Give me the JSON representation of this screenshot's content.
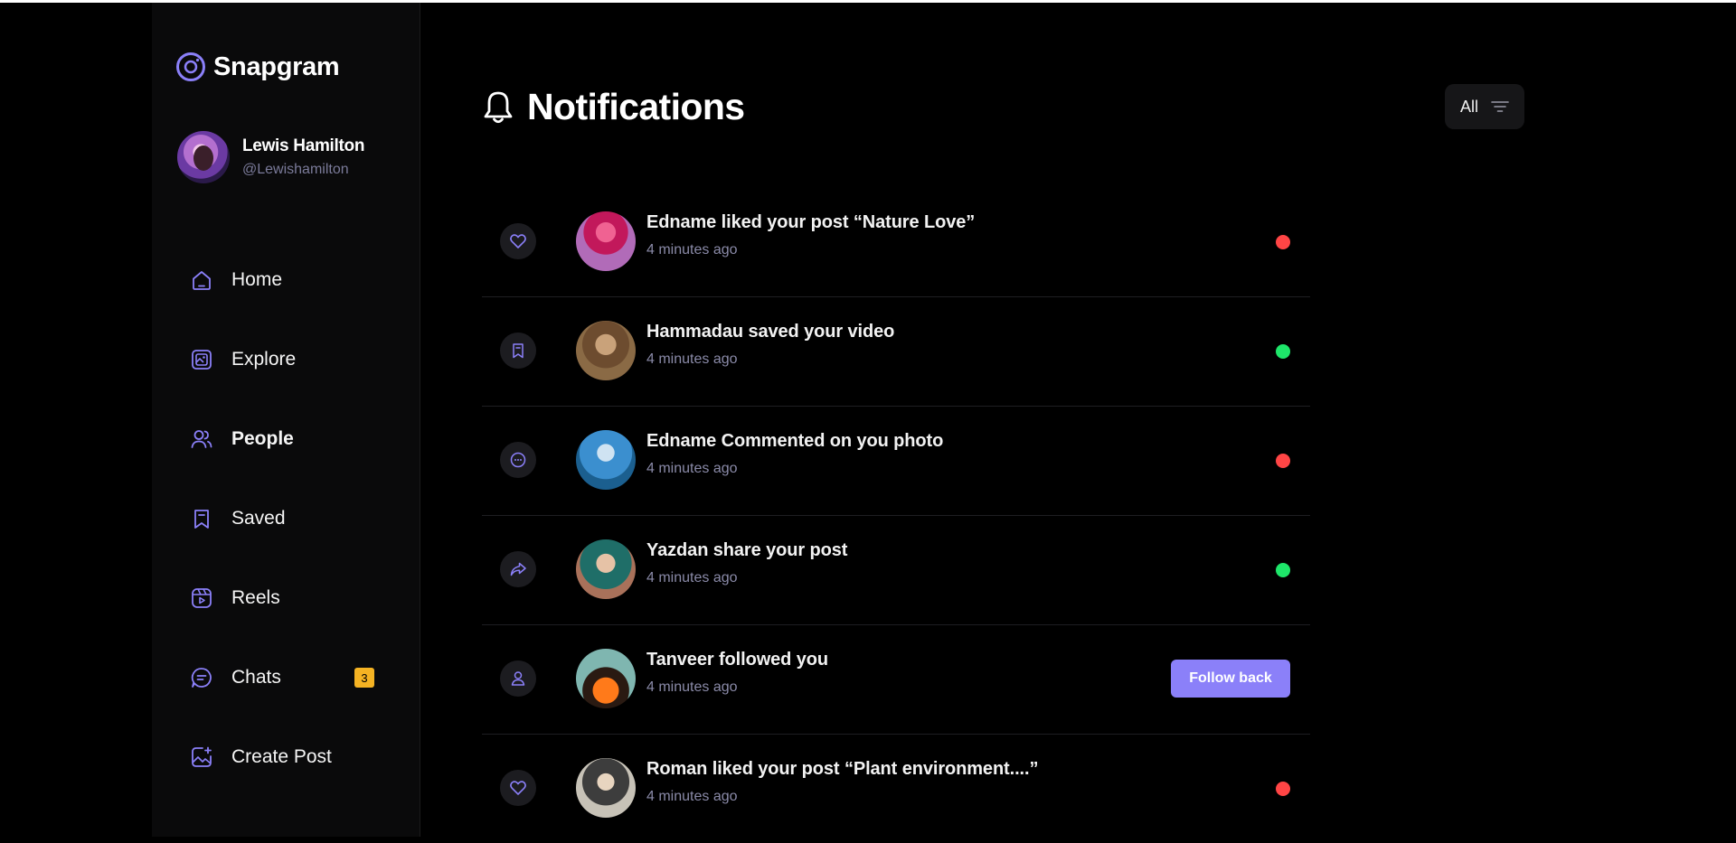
{
  "app": {
    "name": "Snapgram",
    "accent_color": "#8b80f9",
    "logo_icon": "camera-ring-icon"
  },
  "user": {
    "name": "Lewis Hamilton",
    "handle": "@Lewishamilton"
  },
  "sidebar": {
    "items": [
      {
        "label": "Home",
        "icon": "home-icon",
        "active": false
      },
      {
        "label": "Explore",
        "icon": "explore-icon",
        "active": false
      },
      {
        "label": "People",
        "icon": "people-icon",
        "active": true
      },
      {
        "label": "Saved",
        "icon": "bookmark-icon",
        "active": false
      },
      {
        "label": "Reels",
        "icon": "reels-icon",
        "active": false
      },
      {
        "label": "Chats",
        "icon": "chat-icon",
        "active": false,
        "badge": "3"
      },
      {
        "label": "Create Post",
        "icon": "create-post-icon",
        "active": false
      }
    ],
    "badge_color": "#f5b323"
  },
  "header": {
    "title": "Notifications",
    "icon": "bell-icon",
    "filter_label": "All",
    "filter_icon": "filter-lines-icon"
  },
  "notifications": [
    {
      "type": "like",
      "icon": "heart-icon",
      "text": "Edname liked your post “Nature Love”",
      "time": "4 minutes ago",
      "status": "unread",
      "status_color": "#ff4545"
    },
    {
      "type": "save",
      "icon": "bookmark-icon",
      "text": "Hammadau saved your video",
      "time": "4 minutes ago",
      "status": "read",
      "status_color": "#1ee66a"
    },
    {
      "type": "comment",
      "icon": "comment-icon",
      "text": "Edname Commented on you photo",
      "time": "4 minutes ago",
      "status": "unread",
      "status_color": "#ff4545"
    },
    {
      "type": "share",
      "icon": "share-icon",
      "text": "Yazdan share your post",
      "time": "4 minutes ago",
      "status": "read",
      "status_color": "#1ee66a"
    },
    {
      "type": "follow",
      "icon": "user-icon",
      "text": "Tanveer followed you",
      "time": "4 minutes ago",
      "action_label": "Follow back"
    },
    {
      "type": "like",
      "icon": "heart-icon",
      "text": "Roman liked your post “Plant environment....”",
      "time": "4 minutes ago",
      "status": "unread",
      "status_color": "#ff4545"
    }
  ]
}
